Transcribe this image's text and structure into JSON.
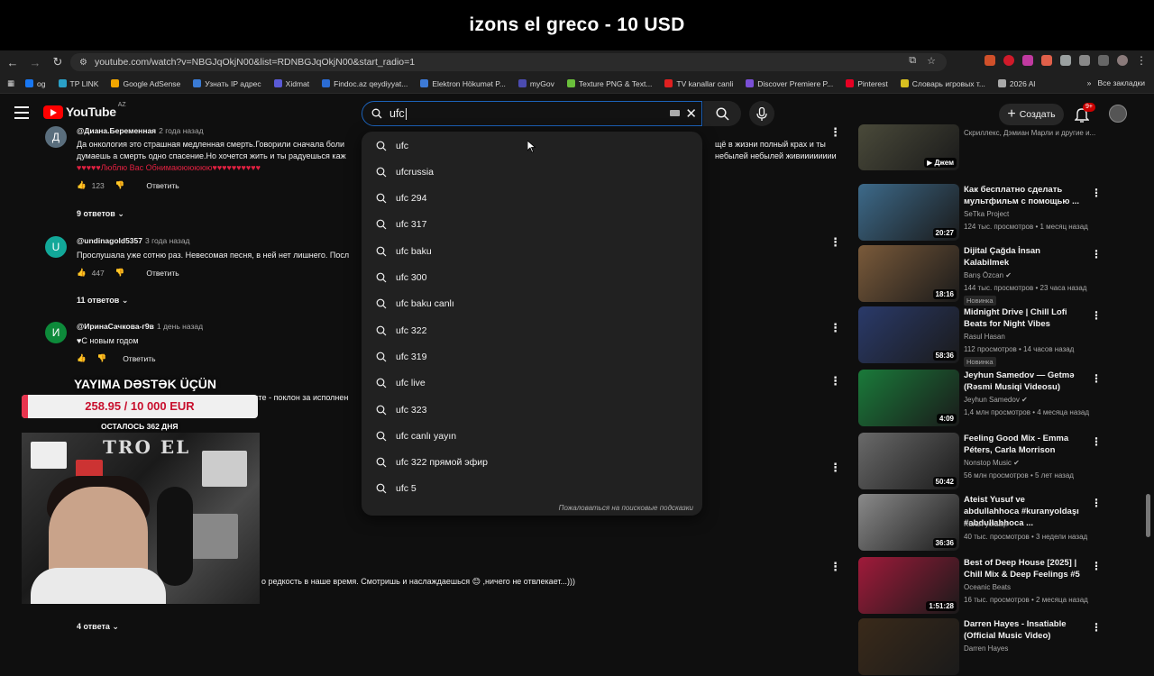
{
  "banner": {
    "text": "izons el greco - 10 USD"
  },
  "browser": {
    "url": "youtube.com/watch?v=NBGJqOkjN00&list=RDNBGJqOkjN00&start_radio=1",
    "bookmarks": [
      {
        "label": "og",
        "color": "#1877f2"
      },
      {
        "label": "TP LINK",
        "color": "#2aa0c7"
      },
      {
        "label": "Google AdSense",
        "color": "#f2a600"
      },
      {
        "label": "Узнать IP адрес",
        "color": "#3a7bd5"
      },
      {
        "label": "Xidmat",
        "color": "#5a5ad6"
      },
      {
        "label": "Findoc.az qeydiyyat...",
        "color": "#2b6cd4"
      },
      {
        "label": "Elektron Hökumət P...",
        "color": "#3d7ad6"
      },
      {
        "label": "myGov",
        "color": "#4b4bb0"
      },
      {
        "label": "Texture PNG & Text...",
        "color": "#6abf3b"
      },
      {
        "label": "TV kanallar canli",
        "color": "#e02020"
      },
      {
        "label": "Discover Premiere P...",
        "color": "#7a4fd6"
      },
      {
        "label": "Pinterest",
        "color": "#e60023"
      },
      {
        "label": "Словарь игровых т...",
        "color": "#d8c020"
      },
      {
        "label": "2026 Al",
        "color": "#aaaaaa"
      }
    ],
    "all_bookmarks": "Все закладки"
  },
  "youtube": {
    "logo": "YouTube",
    "logo_country": "AZ",
    "search_value": "ufc",
    "create_label": "Создать",
    "notif_badge": "9+"
  },
  "suggestions": {
    "items": [
      "ufc",
      "ufcrussia",
      "ufc 294",
      "ufc 317",
      "ufc baku",
      "ufc 300",
      "ufc baku canlı",
      "ufc 322",
      "ufc 319",
      "ufc live",
      "ufc 323",
      "ufc canlı yayın",
      "ufc 322 прямой эфир",
      "ufc 5"
    ],
    "footer": "Пожаловаться на поисковые подсказки"
  },
  "comments": [
    {
      "avatar": "Д",
      "color": "#5a6e7d",
      "author": "@Диана.Беременная",
      "time": "2 года назад",
      "lines": [
        "Да онкология это страшная медленная смерть.Говорили сначала боли",
        "думаешь а смерть одно спасение.Но хочется жить и ты радуешься каж",
        "♥♥♥♥♥Люблю Вас Обнимаюююююю♥♥♥♥♥♥♥♥♥♥"
      ],
      "right_lines": [
        "щё в жизни полный крах и ты",
        "небылей небылей живииииииии"
      ],
      "likes": "123",
      "reply": "Ответить",
      "replies": "9 ответов"
    },
    {
      "avatar": "U",
      "color": "#12a899",
      "author": "@undinagold5357",
      "time": "3 года назад",
      "lines": [
        "Прослушала уже сотню раз. Невесомая песня, в ней нет лишнего. Посл"
      ],
      "likes": "447",
      "reply": "Ответить",
      "replies": "11 ответов"
    },
    {
      "avatar": "И",
      "color": "#0d8a3a",
      "author": "@ИринаСачкова-г9в",
      "time": "1 день назад",
      "lines": [
        "♥С новым годом"
      ],
      "likes": "",
      "reply": "Ответить"
    }
  ],
  "partials": {
    "p1": "ксте - поклон за исполнен",
    "p2": "о редкость в наше время. Смотришь и наслаждаешься 😊 ,ничего не отвлекает...)))",
    "p3": "4 ответа"
  },
  "donation": {
    "title": "YAYIMA DƏSTƏK ÜÇÜN",
    "amount": "258.95 / 10 000 EUR",
    "progress": 0.026,
    "days": "ОСТАЛОСЬ 362 ДНЯ",
    "cam_text": "TRO EL"
  },
  "sidebar": [
    {
      "title": "",
      "channel": "Скриллекс, Дэмиан Марли и другие и...",
      "meta": "",
      "badge": "▶ Джем",
      "thumb": "#4a4a3a",
      "new": ""
    },
    {
      "title": "Как бесплатно сделать мультфильм с помощью ...",
      "channel": "SeTka Project",
      "meta": "124 тыс. просмотров • 1 месяц назад",
      "dur": "20:27",
      "thumb": "#3d6a8a",
      "new": ""
    },
    {
      "title": "Dijital Çağda İnsan Kalabilmek",
      "channel": "Barış Özcan ✔",
      "meta": "144 тыс. просмотров • 23 часа назад",
      "dur": "18:16",
      "thumb": "#7a5a3a",
      "new": "Новинка"
    },
    {
      "title": "Midnight Drive | Chill Lofi Beats for Night Vibes",
      "channel": "Rasul Hasan",
      "meta": "112 просмотров • 14 часов назад",
      "dur": "58:36",
      "thumb": "#2a3a6a",
      "new": "Новинка"
    },
    {
      "title": "Jeyhun Samedov — Getmə (Rəsmi Musiqi Videosu)",
      "channel": "Jeyhun Samedov ✔",
      "meta": "1,4 млн просмотров • 4 месяца назад",
      "dur": "4:09",
      "thumb": "#1a7a3a",
      "new": ""
    },
    {
      "title": "Feeling Good Mix - Emma Péters, Carla Morrison",
      "channel": "Nonstop Music ✔",
      "meta": "56 млн просмотров • 5 лет назад",
      "dur": "50:42",
      "thumb": "#6a6a6a",
      "new": ""
    },
    {
      "title": "Ateist Yusuf ve abdullahhoca #kuranyoldaşı #abdullahhoca ...",
      "channel": "Kuran yoldaşı",
      "meta": "40 тыс. просмотров • 3 недели назад",
      "dur": "36:36",
      "thumb": "#8a8a8a",
      "new": ""
    },
    {
      "title": "Best of Deep House [2025] | Chill Mix & Deep Feelings #5",
      "channel": "Oceanic Beats",
      "meta": "16 тыс. просмотров • 2 месяца назад",
      "dur": "1:51:28",
      "thumb": "#a01a3a",
      "new": ""
    },
    {
      "title": "Darren Hayes - Insatiable (Official Music Video)",
      "channel": "Darren Hayes",
      "meta": "",
      "dur": "",
      "thumb": "#3a2a1a",
      "new": ""
    }
  ]
}
